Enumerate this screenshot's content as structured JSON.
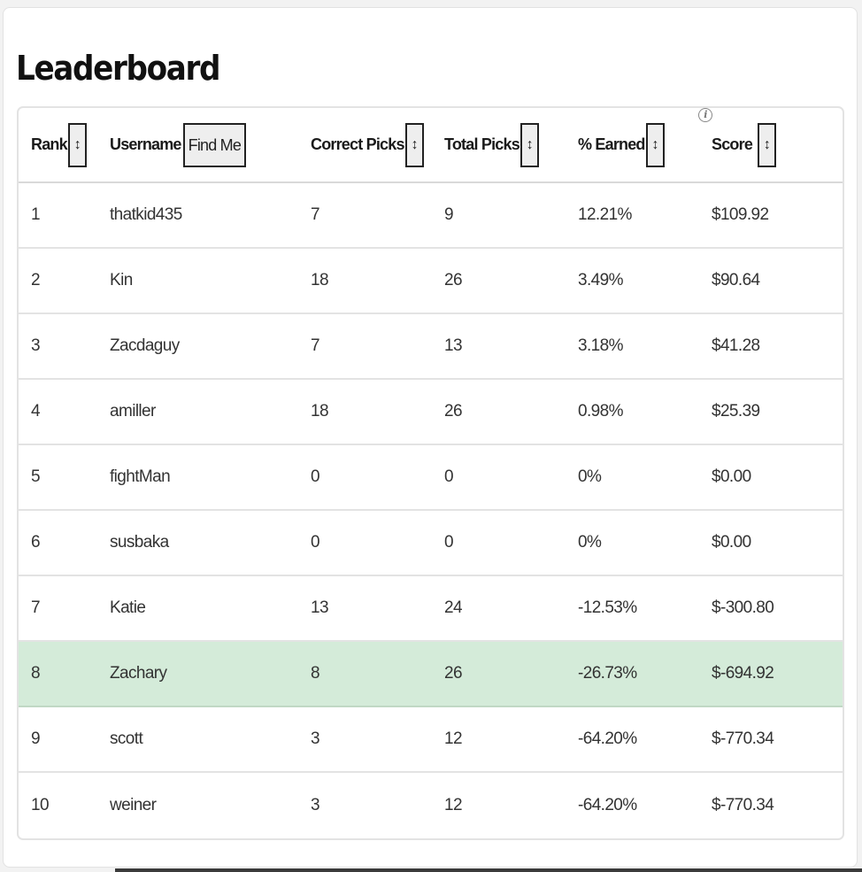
{
  "title": "Leaderboard",
  "columns": {
    "rank": "Rank",
    "username": "Username",
    "find_me": "Find Me",
    "correct_picks": "Correct Picks",
    "total_picks": "Total Picks",
    "earned": "% Earned",
    "score": "Score",
    "sort_icon": "↕",
    "info_icon": "i"
  },
  "rows": [
    {
      "rank": "1",
      "username": "thatkid435",
      "correct": "7",
      "total": "9",
      "earned": "12.21%",
      "score": "$109.92"
    },
    {
      "rank": "2",
      "username": "Kin",
      "correct": "18",
      "total": "26",
      "earned": "3.49%",
      "score": "$90.64"
    },
    {
      "rank": "3",
      "username": "Zacdaguy",
      "correct": "7",
      "total": "13",
      "earned": "3.18%",
      "score": "$41.28"
    },
    {
      "rank": "4",
      "username": "amiller",
      "correct": "18",
      "total": "26",
      "earned": "0.98%",
      "score": "$25.39"
    },
    {
      "rank": "5",
      "username": "fightMan",
      "correct": "0",
      "total": "0",
      "earned": "0%",
      "score": "$0.00"
    },
    {
      "rank": "6",
      "username": "susbaka",
      "correct": "0",
      "total": "0",
      "earned": "0%",
      "score": "$0.00"
    },
    {
      "rank": "7",
      "username": "Katie",
      "correct": "13",
      "total": "24",
      "earned": "-12.53%",
      "score": "$-300.80"
    },
    {
      "rank": "8",
      "username": "Zachary",
      "correct": "8",
      "total": "26",
      "earned": "-26.73%",
      "score": "$-694.92"
    },
    {
      "rank": "9",
      "username": "scott",
      "correct": "3",
      "total": "12",
      "earned": "-64.20%",
      "score": "$-770.34"
    },
    {
      "rank": "10",
      "username": "weiner",
      "correct": "3",
      "total": "12",
      "earned": "-64.20%",
      "score": "$-770.34"
    }
  ],
  "highlight_color": "#d4ebd9"
}
